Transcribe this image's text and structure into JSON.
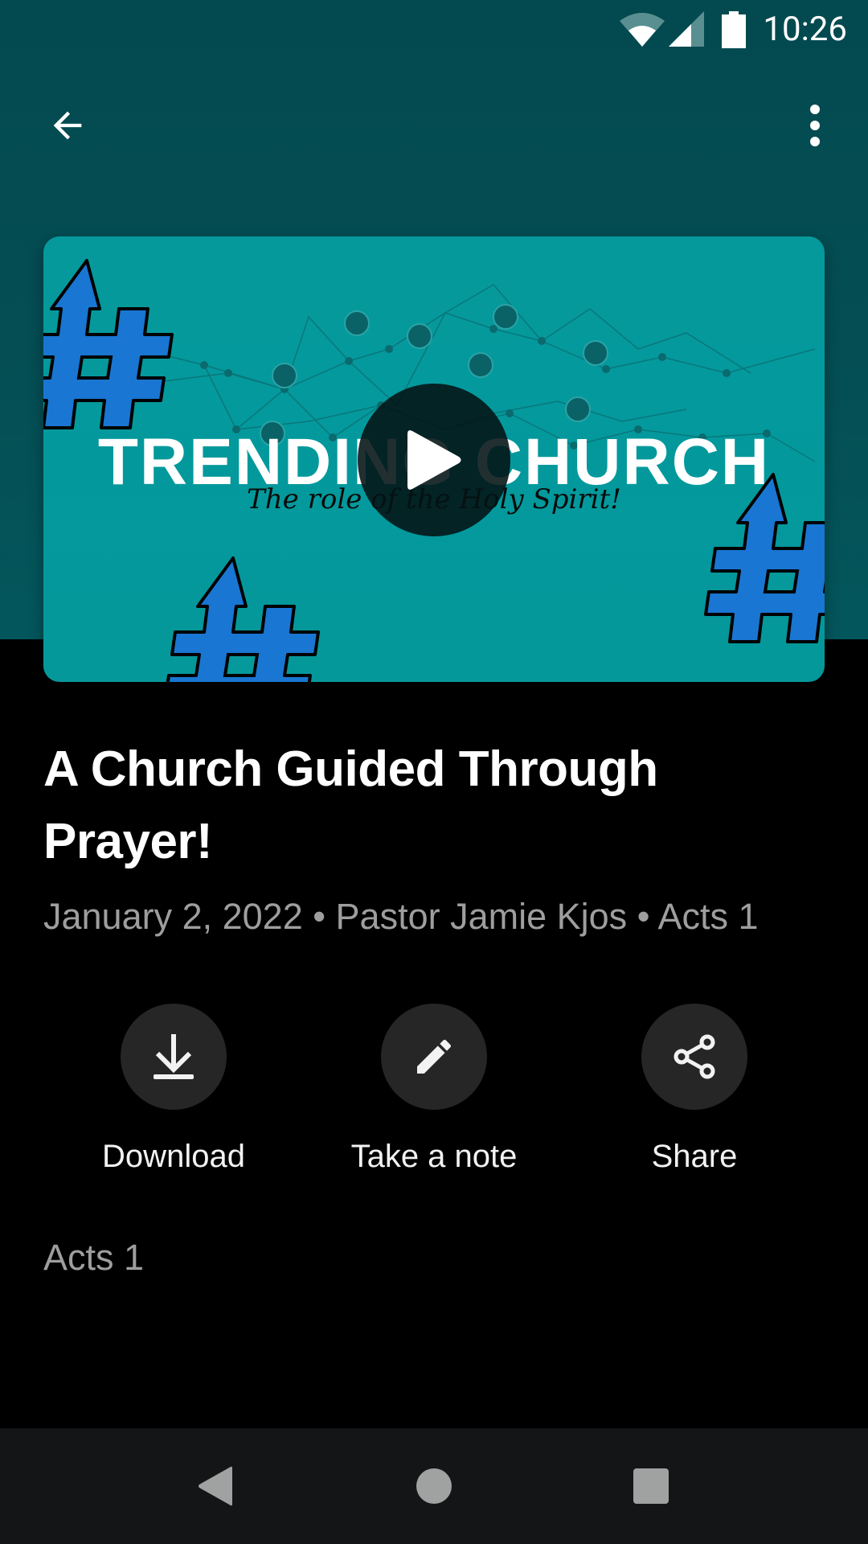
{
  "status_bar": {
    "time": "10:26",
    "icons": [
      "wifi-icon",
      "cellular-signal-icon",
      "battery-icon"
    ]
  },
  "app_bar": {
    "back_icon": "arrow-back-icon",
    "more_icon": "more-vert-icon"
  },
  "video": {
    "thumbnail": {
      "headline": "TRENDING CHURCH",
      "subtitle": "The role of the Holy Spirit!",
      "background_color": "#03999c",
      "hashtag_color": "#1976d2"
    },
    "play_icon": "play-icon"
  },
  "sermon": {
    "title": "A Church Guided Through Prayer!",
    "date": "January 2, 2022",
    "speaker": "Pastor Jamie Kjos",
    "series": "Acts 1",
    "separator": "•",
    "scripture": "Acts 1"
  },
  "actions": [
    {
      "label": "Download",
      "icon": "download-icon"
    },
    {
      "label": "Take a note",
      "icon": "pencil-icon"
    },
    {
      "label": "Share",
      "icon": "share-icon"
    }
  ],
  "nav_bar": {
    "buttons": [
      "back-triangle-icon",
      "home-circle-icon",
      "recents-square-icon"
    ]
  },
  "colors": {
    "header_bg": "#034a50",
    "page_bg": "#000000",
    "action_circle": "#262626",
    "meta_text": "#9e9e9e",
    "navbar_bg": "#141517"
  }
}
